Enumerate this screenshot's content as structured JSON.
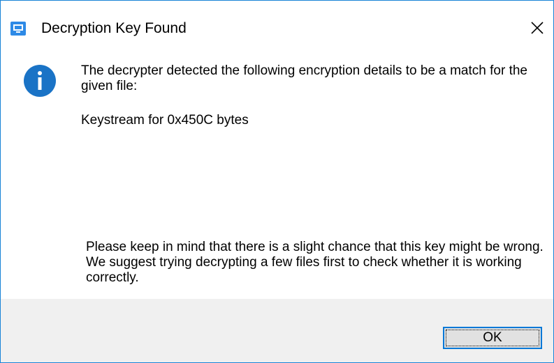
{
  "dialog": {
    "title": "Decryption Key Found",
    "app_icon": "monitor-app-icon",
    "close_icon": "close-icon",
    "info_icon": "info-icon",
    "message": "The decrypter detected the following encryption details to be a match for the given file:",
    "detail": "Keystream for 0x450C bytes",
    "note": "Please keep in mind that there is a slight chance that this key might be wrong. We suggest trying decrypting a few files first to check whether it is working correctly.",
    "ok_label": "OK"
  },
  "colors": {
    "accent": "#0078d7",
    "window_border": "#1883d7",
    "footer_bg": "#f0f0f0",
    "info_icon_bg": "#1a73c6"
  }
}
